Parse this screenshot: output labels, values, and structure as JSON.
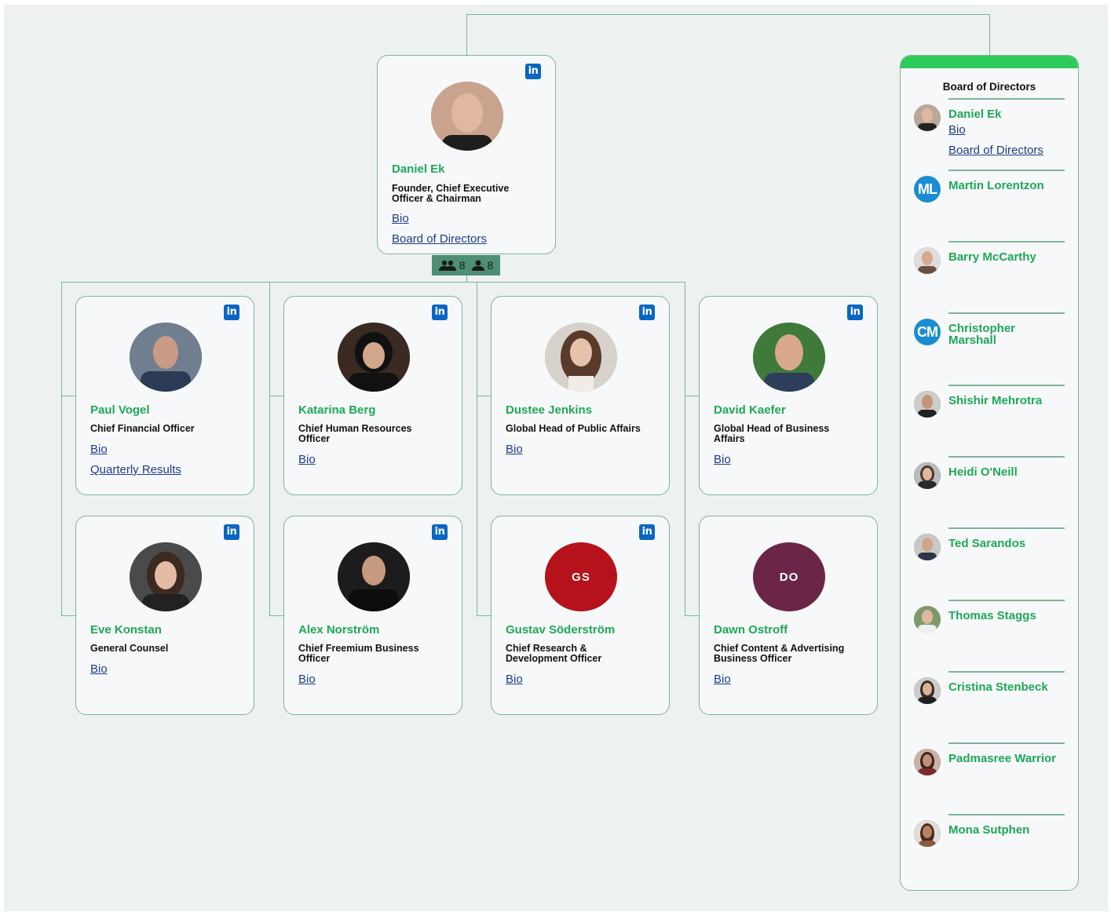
{
  "root": {
    "name": "Daniel Ek",
    "title": "Founder, Chief Executive Officer & Chairman",
    "links": [
      "Bio",
      "Board of Directors"
    ],
    "linkedin": "in",
    "counts": {
      "team": "8",
      "direct": "8"
    }
  },
  "reports": [
    {
      "name": "Paul Vogel",
      "title": "Chief Financial Officer",
      "links": [
        "Bio",
        "Quarterly Results"
      ],
      "linkedin": "in",
      "photo_color": "#3a4f68"
    },
    {
      "name": "Katarina Berg",
      "title": "Chief Human Resources Officer",
      "links": [
        "Bio"
      ],
      "linkedin": "in",
      "photo_color": "#2a1f1c"
    },
    {
      "name": "Dustee Jenkins",
      "title": "Global Head of Public Affairs",
      "links": [
        "Bio"
      ],
      "linkedin": "in",
      "photo_color": "#b79584"
    },
    {
      "name": "David Kaefer",
      "title": "Global Head of Business Affairs",
      "links": [
        "Bio"
      ],
      "linkedin": "in",
      "photo_color": "#3f7a3a"
    },
    {
      "name": "Eve Konstan",
      "title": "General Counsel",
      "links": [
        "Bio"
      ],
      "linkedin": "in",
      "photo_color": "#5a4b44"
    },
    {
      "name": "Alex Norström",
      "title": "Chief Freemium Business Officer",
      "links": [
        "Bio"
      ],
      "linkedin": "in",
      "photo_color": "#1c1c1c"
    },
    {
      "name": "Gustav Söderström",
      "title": "Chief Research & Development Officer",
      "links": [
        "Bio"
      ],
      "linkedin": "in",
      "initials": "GS",
      "photo_color": "#b5121b"
    },
    {
      "name": "Dawn Ostroff",
      "title": "Chief Content & Advertising Business Officer",
      "links": [
        "Bio"
      ],
      "initials": "DO",
      "photo_color": "#6b2647"
    }
  ],
  "board": {
    "title": "Board of Directors",
    "members": [
      {
        "name": "Daniel Ek",
        "links": [
          "Bio",
          "Board of Directors"
        ],
        "avatar_color": "#8a7a70"
      },
      {
        "name": "Martin Lorentzon",
        "initials": "ML",
        "avatar_color": "#1a8dd1"
      },
      {
        "name": "Barry McCarthy",
        "avatar_color": "#9a7a66"
      },
      {
        "name": "Christopher Marshall",
        "initials": "CM",
        "avatar_color": "#1a8dd1"
      },
      {
        "name": "Shishir Mehrotra",
        "avatar_color": "#5b4a44"
      },
      {
        "name": "Heidi O'Neill",
        "avatar_color": "#3d3a44"
      },
      {
        "name": "Ted Sarandos",
        "avatar_color": "#52596b"
      },
      {
        "name": "Thomas Staggs",
        "avatar_color": "#6f8a5a"
      },
      {
        "name": "Cristina Stenbeck",
        "avatar_color": "#3a302c"
      },
      {
        "name": "Padmasree Warrior",
        "avatar_color": "#6b3a33"
      },
      {
        "name": "Mona Sutphen",
        "avatar_color": "#5a3a2c"
      }
    ]
  },
  "colors": {
    "accent": "#1ea75a",
    "line": "#7fb39a",
    "link": "#1f3c88",
    "linkedin": "#0a66c2",
    "board_bar": "#2dcb59"
  },
  "icons": {
    "linkedin": "linkedin-icon",
    "team": "team-icon",
    "person": "person-icon"
  }
}
